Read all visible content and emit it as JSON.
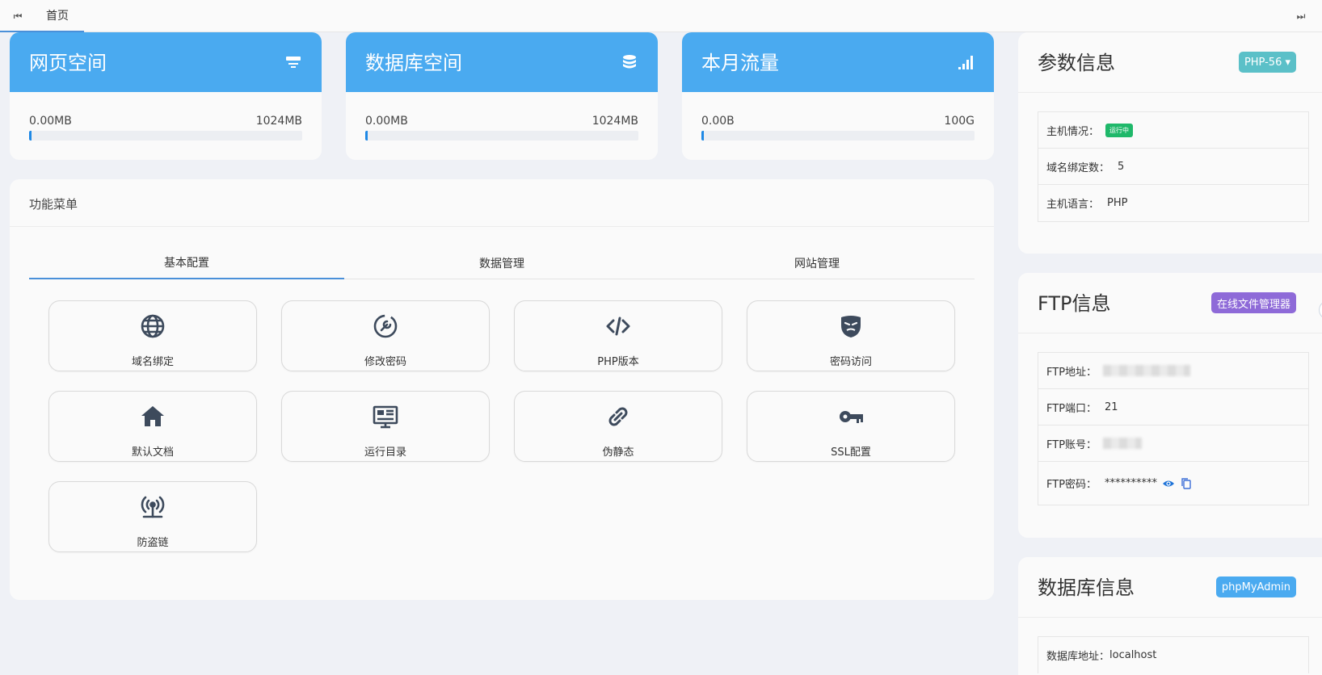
{
  "topbar": {
    "prev_icon": "⏮",
    "next_icon": "⏭",
    "home_tab": "首页"
  },
  "stats": [
    {
      "title": "网页空间",
      "icon": "server-icon",
      "used": "0.00MB",
      "total": "1024MB",
      "progress_percent": 0.5
    },
    {
      "title": "数据库空间",
      "icon": "database-icon",
      "used": "0.00MB",
      "total": "1024MB",
      "progress_percent": 0.5
    },
    {
      "title": "本月流量",
      "icon": "signal-icon",
      "used": "0.00B",
      "total": "100G",
      "progress_percent": 0.5
    }
  ],
  "menu": {
    "title": "功能菜单",
    "tabs": [
      {
        "label": "基本配置",
        "active": true
      },
      {
        "label": "数据管理",
        "active": false
      },
      {
        "label": "网站管理",
        "active": false
      }
    ],
    "tiles": [
      {
        "label": "域名绑定",
        "icon": "globe-icon"
      },
      {
        "label": "修改密码",
        "icon": "wrench-icon"
      },
      {
        "label": "PHP版本",
        "icon": "code-icon"
      },
      {
        "label": "密码访问",
        "icon": "mask-icon"
      },
      {
        "label": "默认文档",
        "icon": "home-icon"
      },
      {
        "label": "运行目录",
        "icon": "monitor-list-icon"
      },
      {
        "label": "伪静态",
        "icon": "link-icon"
      },
      {
        "label": "SSL配置",
        "icon": "key-icon"
      },
      {
        "label": "防盗链",
        "icon": "antenna-icon"
      }
    ]
  },
  "params": {
    "title": "参数信息",
    "php_button": "PHP-56 ▾",
    "host_status_label": "主机情况：",
    "host_status_badge": "运行中",
    "domain_count_label": "域名绑定数：",
    "domain_count": "5",
    "language_label": "主机语言：",
    "language": "PHP",
    "colors": {
      "button": "#5bc0c8",
      "badge": "#1fb86a"
    }
  },
  "ftp": {
    "title": "FTP信息",
    "file_manager_button": "在线文件管理器",
    "address_label": "FTP地址：",
    "port_label": "FTP端口：",
    "port": "21",
    "account_label": "FTP账号：",
    "password_label": "FTP密码：",
    "password_masked": "**********",
    "colors": {
      "button": "#8e6ad8"
    }
  },
  "database": {
    "title": "数据库信息",
    "admin_button": "phpMyAdmin",
    "address_label": "数据库地址：",
    "address": "localhost",
    "colors": {
      "button": "#4aaaf0"
    }
  }
}
